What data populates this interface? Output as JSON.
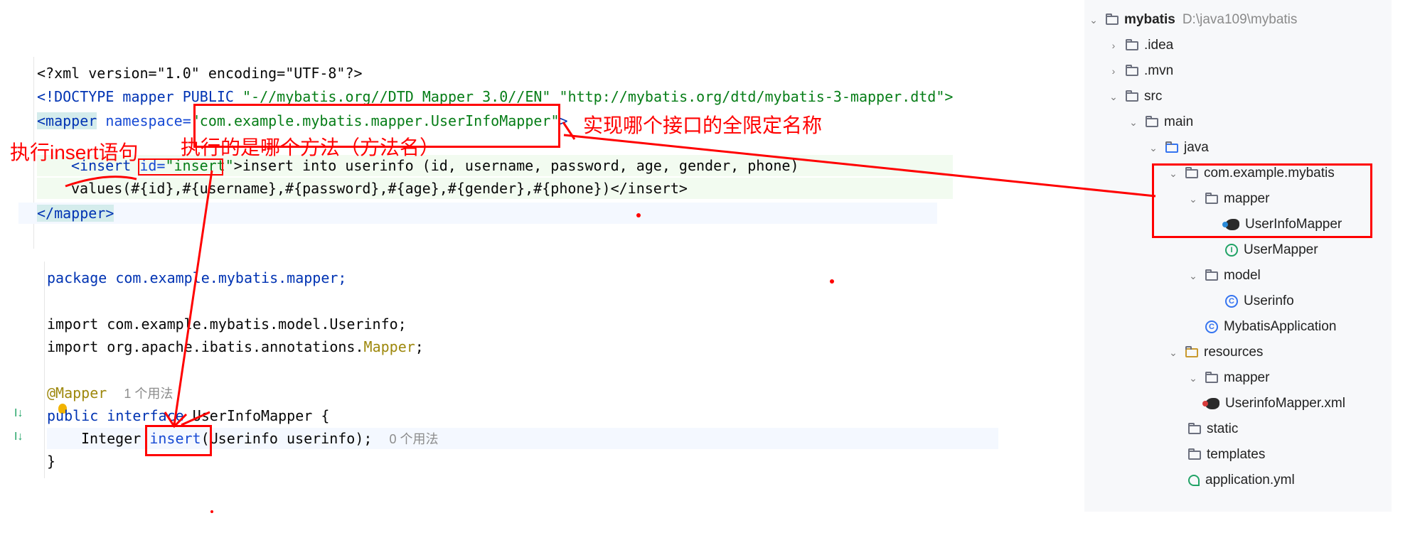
{
  "xml_code": {
    "line1": "<?xml version=\"1.0\" encoding=\"UTF-8\"?>",
    "line2_tag": "<!DOCTYPE mapper PUBLIC ",
    "line2_str1": "\"-//mybatis.org//DTD Mapper 3.0//EN\"",
    "line2_str2": " \"http://mybatis.org/dtd/mybatis-3-mapper.dtd\">",
    "line3_open": "<mapper",
    "line3_attr": " namespace=",
    "line3_val": "\"com.example.mybatis.mapper.UserInfoMapper\"",
    "line3_close": ">",
    "line4_tag": "<insert ",
    "line4_attr": "id=",
    "line4_val": "\"insert\"",
    "line4_rest": ">insert into userinfo (id, username, password, age, gender, phone)",
    "line5": "values(#{id},#{username},#{password},#{age},#{gender},#{phone})</insert>",
    "line6": "</mapper>"
  },
  "java_code": {
    "line1": "package com.example.mybatis.mapper;",
    "line2": "import com.example.mybatis.model.Userinfo;",
    "line3_a": "import org.apache.ibatis.annotations.",
    "line3_b": "Mapper",
    "line3_c": ";",
    "line4_ann": "@Mapper",
    "line4_hint": "1 个用法",
    "line5_kw": "public interface ",
    "line5_rest": "UserInfoMapper {",
    "line6_a": "Integer ",
    "line6_b": "insert",
    "line6_c": "(Userinfo userinfo);",
    "line6_hint": "0 个用法",
    "line7": "}"
  },
  "tree": {
    "root_name": "mybatis",
    "root_path": "D:\\java109\\mybatis",
    "items": [
      {
        "label": ".idea",
        "icon": "folder-icon"
      },
      {
        "label": ".mvn",
        "icon": "folder-icon"
      },
      {
        "label": "src",
        "icon": "folder-icon"
      },
      {
        "label": "main",
        "icon": "folder-icon"
      },
      {
        "label": "java",
        "icon": "source-folder-icon"
      },
      {
        "label": "com.example.mybatis",
        "icon": "package-icon"
      },
      {
        "label": "mapper",
        "icon": "package-icon"
      },
      {
        "label": "UserInfoMapper",
        "icon": "mybatis-mapper-icon"
      },
      {
        "label": "UserMapper",
        "icon": "interface-icon"
      },
      {
        "label": "model",
        "icon": "package-icon"
      },
      {
        "label": "Userinfo",
        "icon": "class-icon"
      },
      {
        "label": "MybatisApplication",
        "icon": "spring-app-icon"
      },
      {
        "label": "resources",
        "icon": "resources-folder-icon"
      },
      {
        "label": "mapper",
        "icon": "folder-icon"
      },
      {
        "label": "UserinfoMapper.xml",
        "icon": "mybatis-xml-icon"
      },
      {
        "label": "static",
        "icon": "folder-icon"
      },
      {
        "label": "templates",
        "icon": "folder-icon"
      },
      {
        "label": "application.yml",
        "icon": "yaml-icon"
      }
    ]
  },
  "annotations": {
    "insert_stmt": "执行insert语句",
    "method_name": "执行的是哪个方法（方法名）",
    "interface_name": "实现哪个接口的全限定名称"
  },
  "colors": {
    "annotation": "#ff0000",
    "keyword": "#0033b3",
    "string": "#067d17",
    "annotation_java": "#9e880d"
  }
}
